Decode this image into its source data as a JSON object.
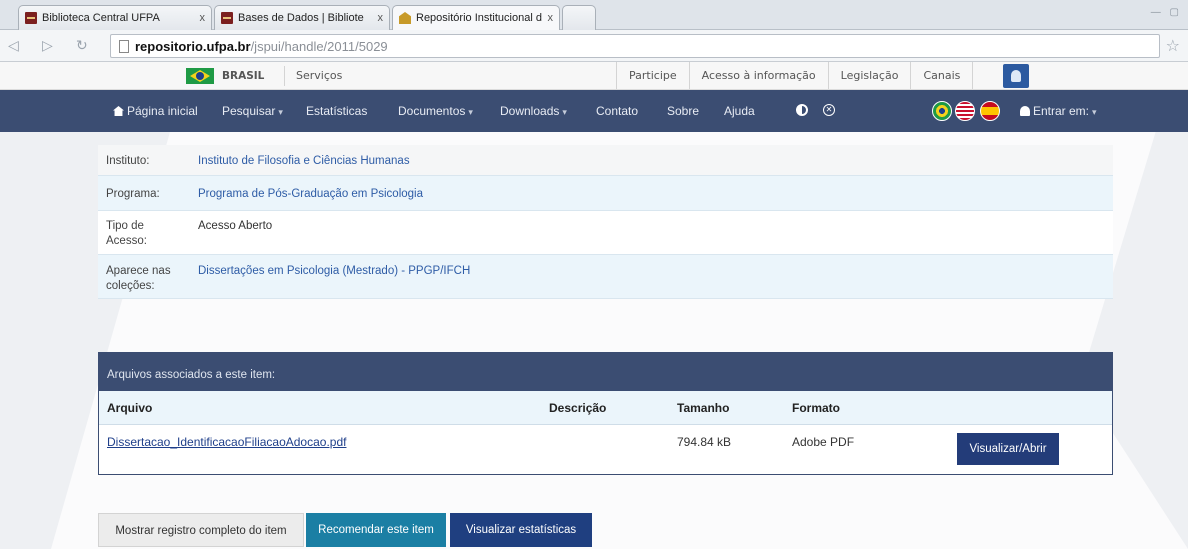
{
  "browser": {
    "tabs": [
      {
        "label": "Biblioteca Central UFPA",
        "close": "x"
      },
      {
        "label": "Bases de Dados | Bibliote",
        "close": "x"
      },
      {
        "label": "Repositório Institucional d",
        "close": "x"
      }
    ],
    "url_host": "repositorio.ufpa.br",
    "url_path": "/jspui/handle/2011/5029"
  },
  "govbar": {
    "brasil": "BRASIL",
    "servicos": "Serviços",
    "links": [
      "Participe",
      "Acesso à informação",
      "Legislação",
      "Canais"
    ]
  },
  "nav": {
    "home": "Página inicial",
    "pesquisar": "Pesquisar",
    "estatisticas": "Estatísticas",
    "documentos": "Documentos",
    "downloads": "Downloads",
    "contato": "Contato",
    "sobre": "Sobre",
    "ajuda": "Ajuda",
    "login": "Entrar em:"
  },
  "meta": {
    "instituto_label": "Instituto:",
    "instituto_value": "Instituto de Filosofia e Ciências Humanas",
    "programa_label": "Programa:",
    "programa_value": "Programa de Pós-Graduação em Psicologia",
    "tipo_label_1": "Tipo de",
    "tipo_label_2": "Acesso:",
    "tipo_value": "Acesso Aberto",
    "colecoes_label_1": "Aparece nas",
    "colecoes_label_2": "coleções:",
    "colecoes_value": "Dissertações em Psicologia (Mestrado) - PPGP/IFCH"
  },
  "files": {
    "heading": "Arquivos associados a este item:",
    "columns": {
      "arquivo": "Arquivo",
      "descricao": "Descrição",
      "tamanho": "Tamanho",
      "formato": "Formato"
    },
    "rows": [
      {
        "name": "Dissertacao_IdentificacaoFiliacaoAdocao.pdf",
        "description": "",
        "size": "794.84 kB",
        "format": "Adobe PDF",
        "button": "Visualizar/Abrir"
      }
    ]
  },
  "actions": {
    "full_record": "Mostrar registro completo do item",
    "recommend": "Recomendar este item",
    "statistics": "Visualizar estatísticas"
  }
}
